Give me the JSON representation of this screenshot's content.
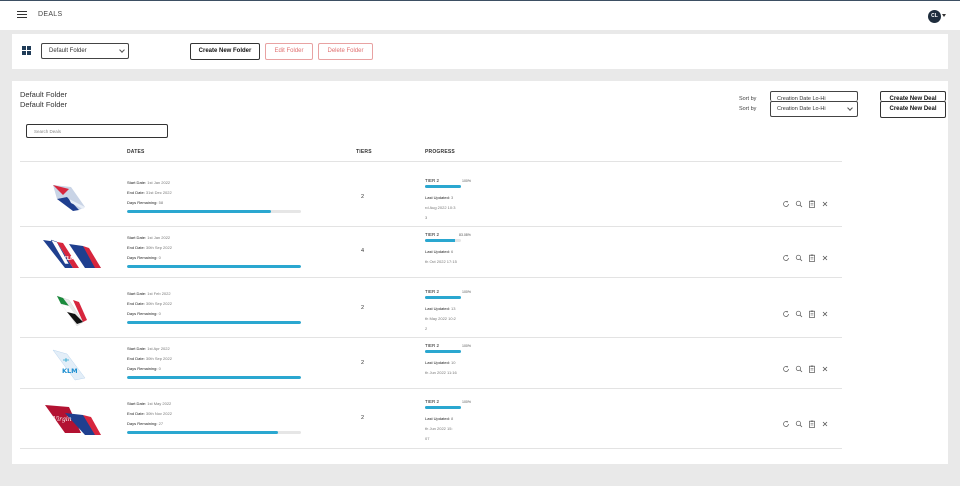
{
  "app": {
    "title": "DEALS",
    "user_initials": "CL"
  },
  "folder_bar": {
    "selected_folder": "Default Folder",
    "create_folder_label": "Create New Folder",
    "edit_folder_label": "Edit Folder",
    "delete_folder_label": "Delete Folder"
  },
  "panel": {
    "folder_title_1": "Default Folder",
    "folder_title_2": "Default Folder",
    "sort_label": "Sort by",
    "sort_value": "Creation Date Lo-Hi",
    "create_deal_label": "Create New Deal",
    "search_placeholder": "Search Deals",
    "columns": {
      "dates": "DATES",
      "tiers": "TIERS",
      "progress": "PROGRESS"
    }
  },
  "labels": {
    "start": "Start Date:",
    "end": "End Date:",
    "days": "Days Remaining:",
    "last_updated": "Last Updated:"
  },
  "colors": {
    "accent": "#2aa7d0",
    "danger": "#e07070",
    "avatar": "#1f2d3d"
  },
  "deals": [
    {
      "airline": "British Airways",
      "start": "1st Jan 2022",
      "end": "31st Dec 2022",
      "days": "58",
      "days_fraction": 0.83,
      "tiers": "2",
      "tier_name": "TIER 2",
      "tier_pct": "100%",
      "tier_fraction": 1.0,
      "updated_1": "3",
      "updated_2": "rd Aug 2022 10:3",
      "updated_3": "3"
    },
    {
      "airline": "Air France KLM Delta",
      "start": "1st Jan 2022",
      "end": "30th Sep 2022",
      "days": "0",
      "days_fraction": 1.0,
      "tiers": "4",
      "tier_name": "TIER 2",
      "tier_pct": "83.08%",
      "tier_fraction": 0.83,
      "updated_1": "6",
      "updated_2": "th Oct 2022 17:15",
      "updated_3": ""
    },
    {
      "airline": "Emirates",
      "start": "1st Feb 2022",
      "end": "30th Sep 2022",
      "days": "0",
      "days_fraction": 1.0,
      "tiers": "2",
      "tier_name": "TIER 2",
      "tier_pct": "100%",
      "tier_fraction": 1.0,
      "updated_1": "13",
      "updated_2": "th May 2022 10:2",
      "updated_3": "2"
    },
    {
      "airline": "KLM",
      "start": "1st Apr 2022",
      "end": "30th Sep 2022",
      "days": "0",
      "days_fraction": 1.0,
      "tiers": "2",
      "tier_name": "TIER 2",
      "tier_pct": "100%",
      "tier_fraction": 1.0,
      "updated_1": "10",
      "updated_2": "th Jun 2022 11:16",
      "updated_3": ""
    },
    {
      "airline": "Virgin Atlantic Delta",
      "start": "1st May 2022",
      "end": "30th Nov 2022",
      "days": "27",
      "days_fraction": 0.87,
      "tiers": "2",
      "tier_name": "TIER 2",
      "tier_pct": "100%",
      "tier_fraction": 1.0,
      "updated_1": "8",
      "updated_2": "th Jun 2022 15:",
      "updated_3": "07"
    }
  ]
}
